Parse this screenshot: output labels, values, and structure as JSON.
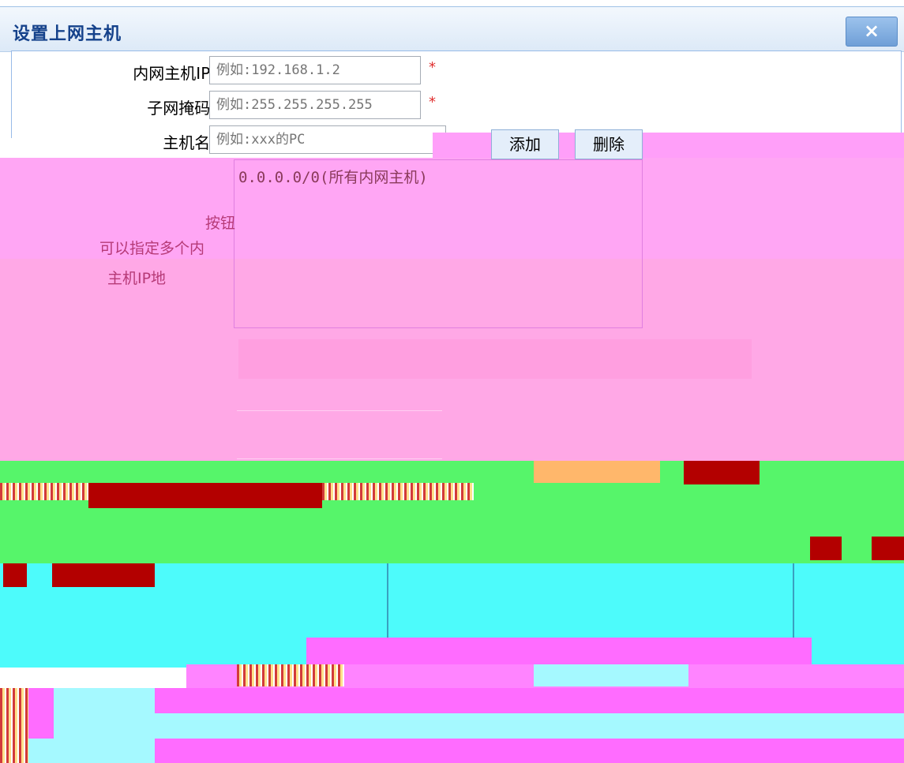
{
  "dialog": {
    "title": "设置上网主机",
    "close_glyph": "×"
  },
  "form": {
    "ip_label": "内网主机IP:",
    "ip_placeholder": "例如:192.168.1.2",
    "mask_label": "子网掩码:",
    "mask_placeholder": "例如:255.255.255.255",
    "host_label": "主机名:",
    "host_placeholder": "例如:xxx的PC",
    "required_mark": "*",
    "add_label": "添加",
    "delete_label": "删除"
  },
  "host_list": {
    "items": [
      "0.0.0.0/0(所有内网主机)"
    ]
  },
  "hint": {
    "line1": "按钮",
    "line2": "可以指定多个内",
    "line3": "主机IP地"
  },
  "colors": {
    "title_text": "#15428b",
    "required": "#e03030",
    "overlay_pink": "#ff9ff9"
  }
}
